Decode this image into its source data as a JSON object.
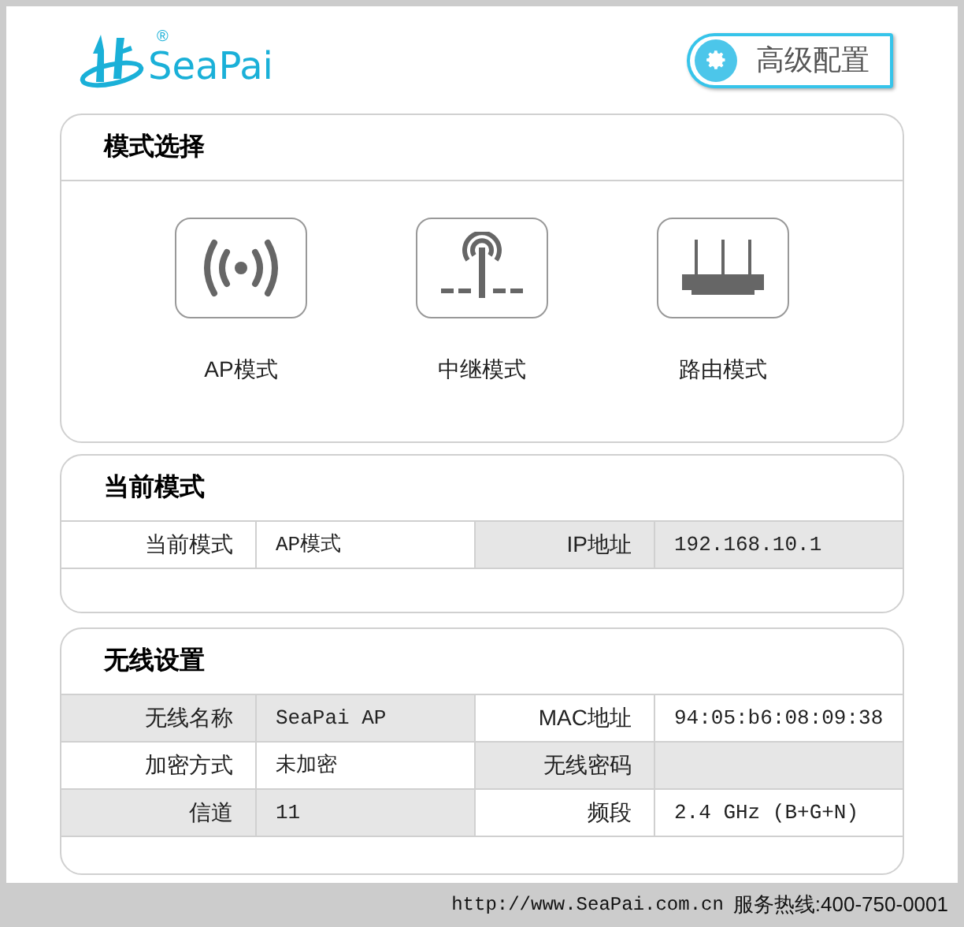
{
  "logo": {
    "text": "SeaPai",
    "mark": "®"
  },
  "advanced_button": {
    "label": "高级配置"
  },
  "mode_select": {
    "title": "模式选择",
    "modes": [
      {
        "kind": "ap",
        "label": "AP模式"
      },
      {
        "kind": "repeater",
        "label": "中继模式"
      },
      {
        "kind": "router",
        "label": "路由模式"
      }
    ]
  },
  "current_mode": {
    "title": "当前模式",
    "rows": [
      [
        {
          "label": "当前模式",
          "value": "AP模式",
          "shaded": false
        },
        {
          "label": "IP地址",
          "value": "192.168.10.1",
          "shaded": true
        }
      ]
    ]
  },
  "wireless": {
    "title": "无线设置",
    "rows": [
      [
        {
          "label": "无线名称",
          "value": "SeaPai AP",
          "shaded": true
        },
        {
          "label": "MAC地址",
          "value": "94:05:b6:08:09:38",
          "shaded": false
        }
      ],
      [
        {
          "label": "加密方式",
          "value": "未加密",
          "shaded": false
        },
        {
          "label": "无线密码",
          "shaded": true
        }
      ],
      [
        {
          "label": "信道",
          "value": "11",
          "shaded": true
        },
        {
          "label": "频段",
          "value": "2.4 GHz (B+G+N)",
          "shaded": false
        }
      ]
    ]
  },
  "footer": {
    "url": "http://www.SeaPai.com.cn",
    "hotline": "服务热线:400-750-0001"
  }
}
